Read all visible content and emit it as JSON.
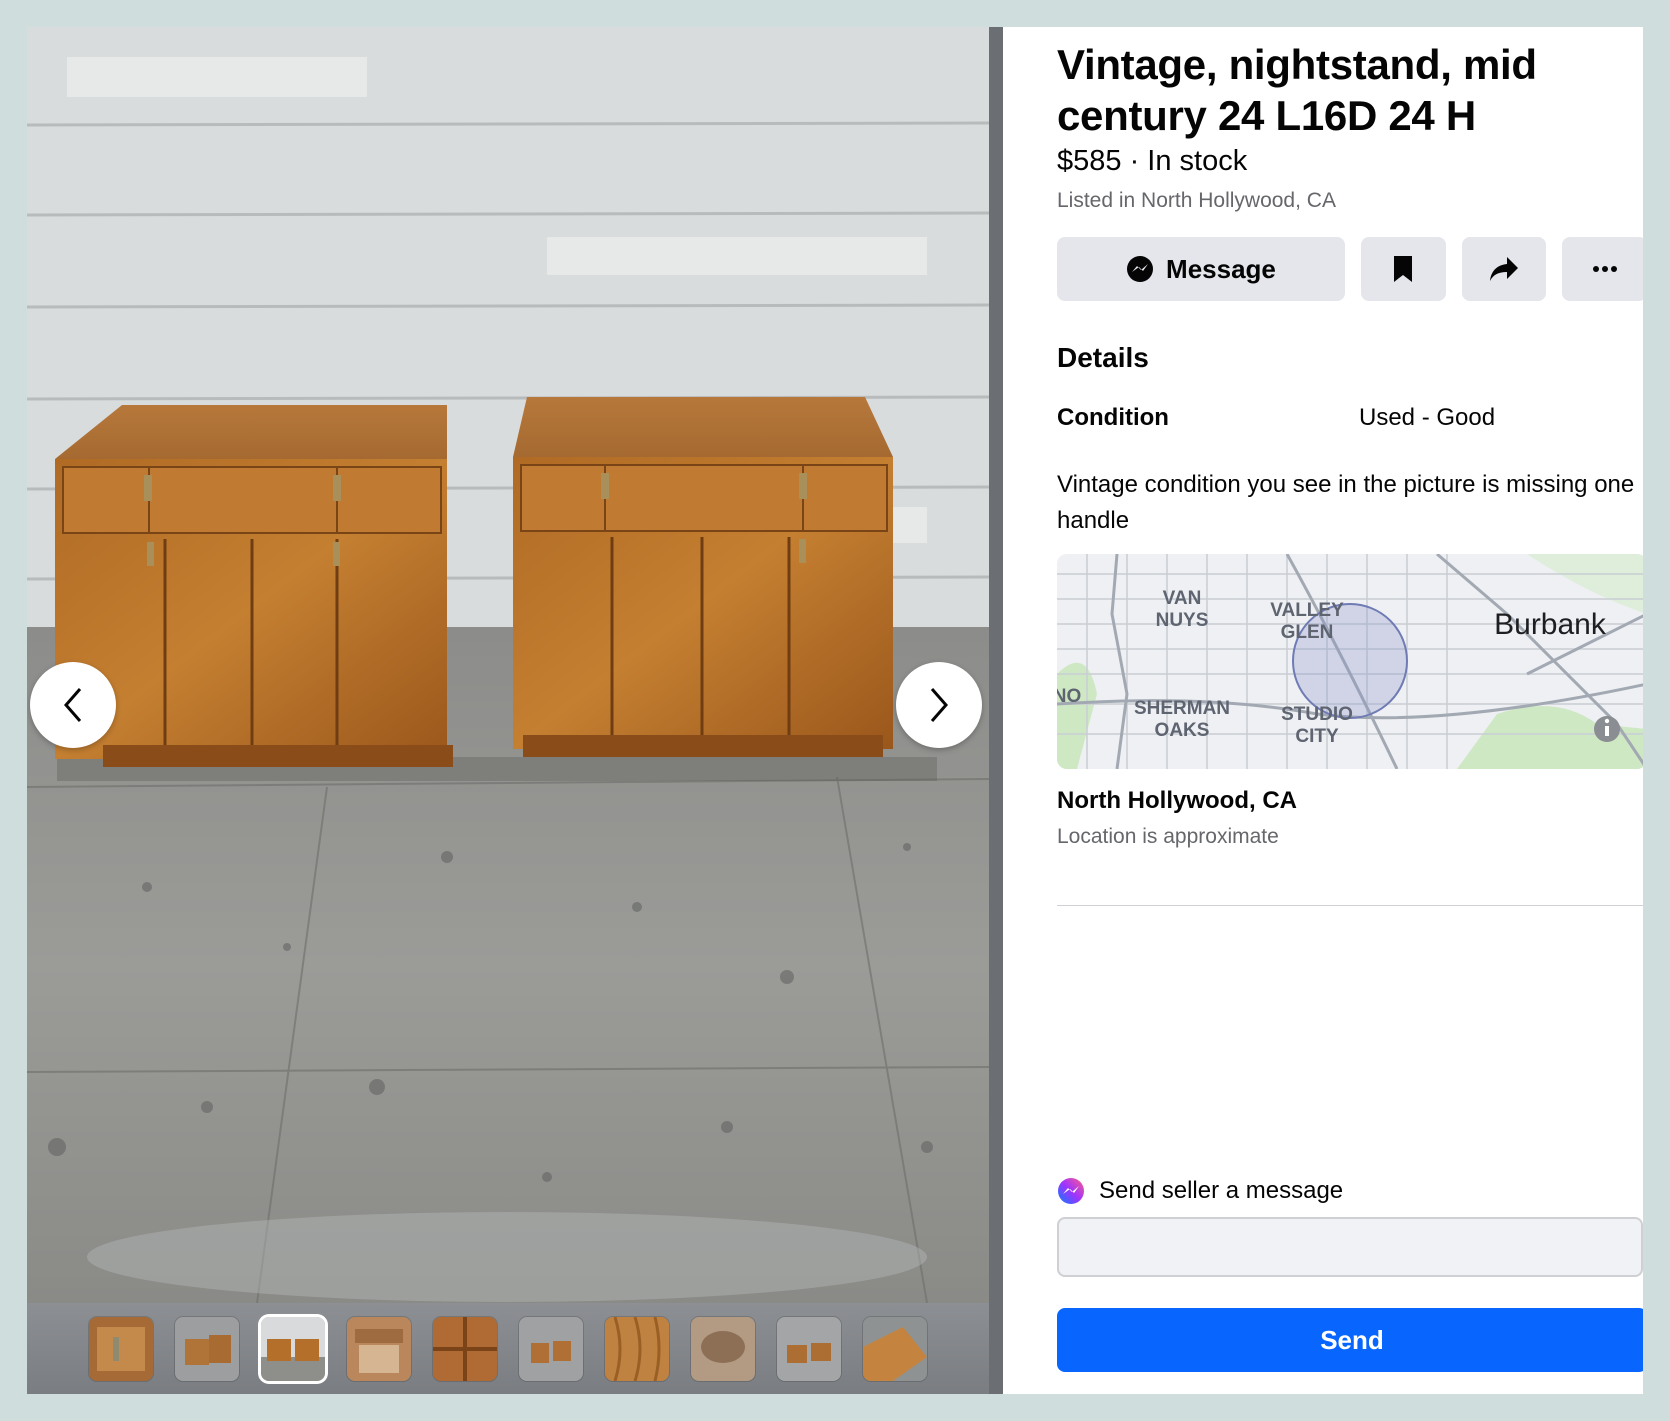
{
  "listing": {
    "title": "Vintage, nightstand, mid century 24 L16D 24 H",
    "price_line": "$585 · In stock",
    "listed_in": "Listed in North Hollywood, CA"
  },
  "actions": {
    "message_label": "Message",
    "save_icon": "bookmark-icon",
    "share_icon": "share-arrow-icon",
    "more_icon": "more-dots-icon"
  },
  "details": {
    "heading": "Details",
    "condition_label": "Condition",
    "condition_value": "Used - Good",
    "description": "Vintage condition you see in the picture is missing one handle"
  },
  "map": {
    "labels": [
      "VAN",
      "NUYS",
      "VALLEY",
      "GLEN",
      "Burbank",
      "SHERMAN",
      "OAKS",
      "STUDIO",
      "CITY",
      "NO"
    ],
    "info_icon": "info-icon"
  },
  "location": {
    "name": "North Hollywood, CA",
    "note": "Location is approximate"
  },
  "message_box": {
    "label": "Send seller a message",
    "input_value": "",
    "send_label": "Send"
  },
  "gallery": {
    "thumbnail_count": 10,
    "active_index": 2,
    "prev_icon": "chevron-left-icon",
    "next_icon": "chevron-right-icon"
  },
  "colors": {
    "accent": "#0866ff",
    "button_bg": "#e4e6eb",
    "secondary_text": "#65676b",
    "page_bg": "#cfdedd"
  }
}
